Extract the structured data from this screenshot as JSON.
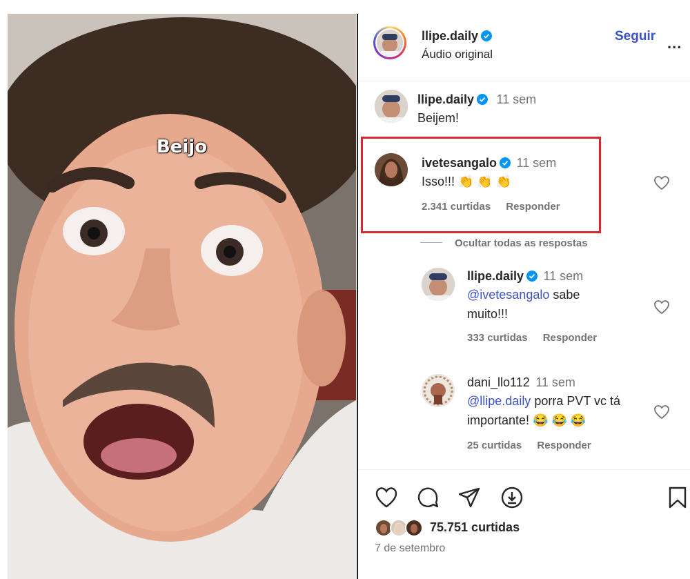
{
  "video": {
    "caption": "Beijo"
  },
  "post_header": {
    "username": "llipe.daily",
    "subtitle": "Áudio original",
    "follow_label": "Seguir",
    "more_label": "..."
  },
  "caption_comment": {
    "username": "llipe.daily",
    "time": "11 sem",
    "text": "Beijem!"
  },
  "comments": [
    {
      "username": "ivetesangalo",
      "time": "11 sem",
      "text": "Isso!!! 👏 👏 👏",
      "likes": "2.341 curtidas",
      "reply_label": "Responder",
      "hide_replies_label": "Ocultar todas as respostas",
      "replies": [
        {
          "username": "llipe.daily",
          "time": "11 sem",
          "mention": "@ivetesangalo",
          "text_line1": " sabe",
          "text_line2": "muito!!!",
          "likes": "333 curtidas",
          "reply_label": "Responder"
        },
        {
          "username": "dani_llo112",
          "time": "11 sem",
          "mention": "@llipe.daily",
          "text_line1": " porra PVT vc tá",
          "text_line2": "importante! 😂 😂 😂",
          "likes": "25 curtidas",
          "reply_label": "Responder"
        }
      ]
    }
  ],
  "footer": {
    "likes": "75.751 curtidas",
    "date": "7 de setembro"
  },
  "colors": {
    "accent": "#3b52c4",
    "verified": "#0095f6",
    "highlight_border": "#d7282f",
    "muted_text": "#737373"
  },
  "icons": [
    "heart-icon",
    "comment-icon",
    "share-icon",
    "download-icon",
    "bookmark-icon",
    "verified-badge-icon",
    "more-icon"
  ]
}
